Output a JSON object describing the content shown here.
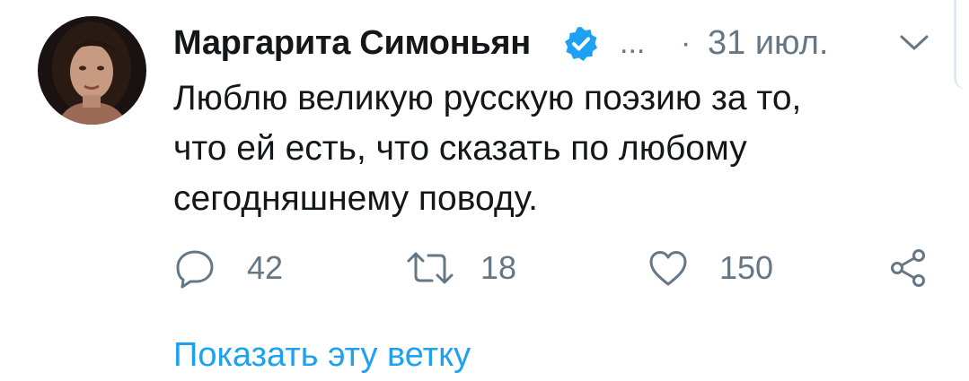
{
  "author": {
    "name": "Маргарита Симоньян",
    "handle_truncated": "...",
    "separator": "·",
    "date": "31 июл."
  },
  "tweet": {
    "lines": [
      "Люблю великую русскую поэзию за то,",
      "что ей есть, что сказать по любому",
      "сегодняшнему поводу."
    ]
  },
  "actions": {
    "reply_count": "42",
    "retweet_count": "18",
    "like_count": "150"
  },
  "thread_link": "Показать эту ветку",
  "icons": {
    "avatar": "avatar",
    "verified": "verified-badge-icon",
    "more": "chevron-down-icon",
    "reply": "reply-icon",
    "retweet": "retweet-icon",
    "like": "heart-icon",
    "share": "share-icon"
  },
  "colors": {
    "text": "#14171a",
    "muted": "#657786",
    "accent": "#1da1f2"
  }
}
